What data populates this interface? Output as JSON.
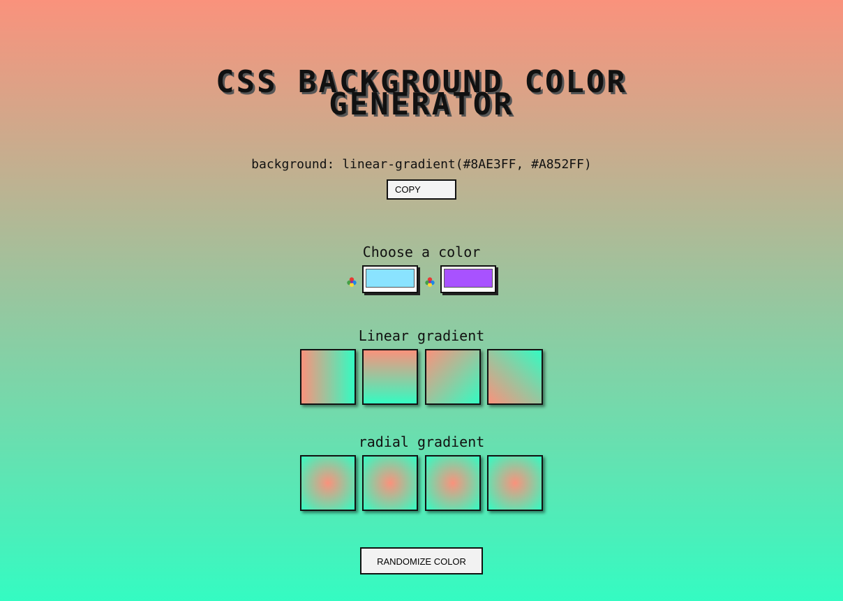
{
  "title": {
    "line1": "CSS BACKGROUND COLOR",
    "line2": "GENERATOR"
  },
  "css_output": "background: linear-gradient(#8AE3FF, #A852FF)",
  "copy_button": "COPY",
  "choose_color_label": "Choose a color",
  "colors": {
    "color1": "#8AE3FF",
    "color2": "#A852FF",
    "page_top": "#FA927C",
    "page_bottom": "#34FBC2"
  },
  "picker_icon": "palette-icon",
  "linear_label": "Linear gradient",
  "linear_gradients": [
    "to right",
    "to bottom",
    "to bottom right",
    "to top right"
  ],
  "radial_label": "radial gradient",
  "radial_gradients": [
    "circle",
    "circle",
    "circle",
    "circle"
  ],
  "randomize_button": "RANDOMIZE COLOR"
}
